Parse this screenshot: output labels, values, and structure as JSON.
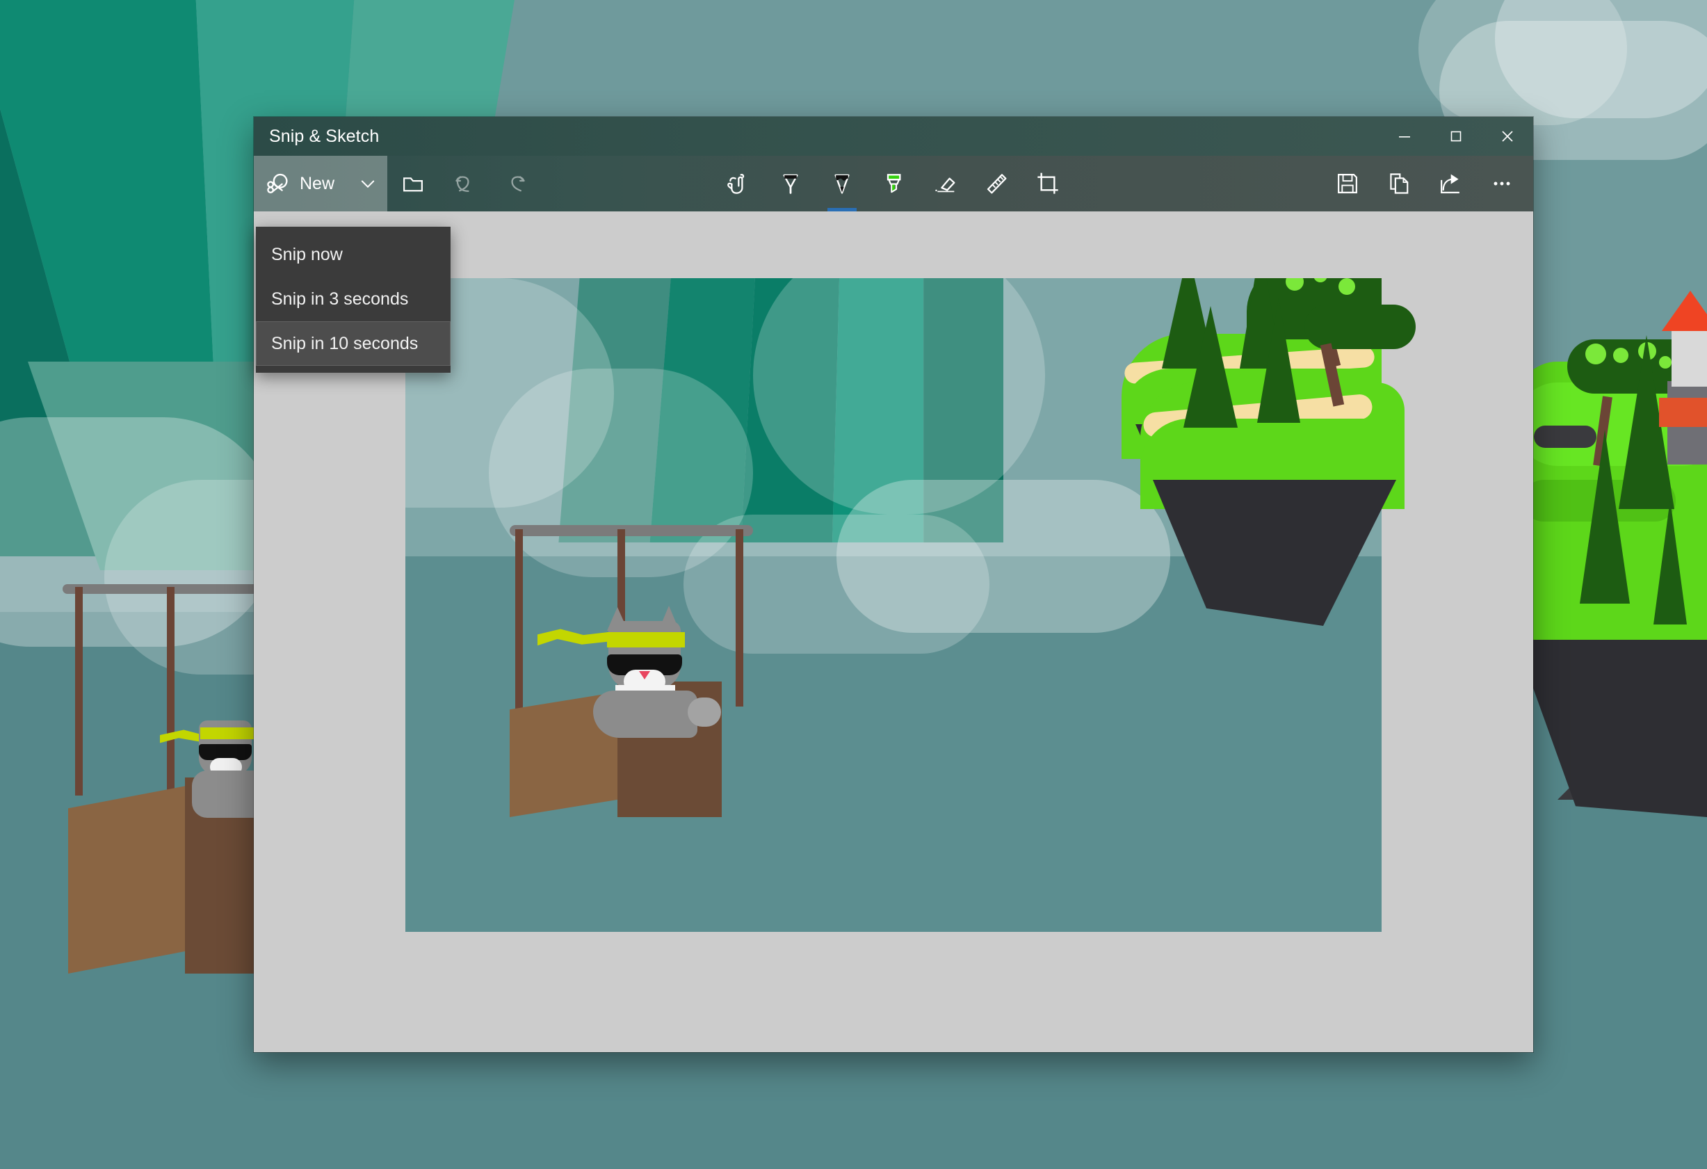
{
  "window": {
    "title": "Snip & Sketch",
    "controls": [
      {
        "name": "minimize",
        "glyph": "minimize-icon",
        "tooltip": "Minimize"
      },
      {
        "name": "maximize",
        "glyph": "maximize-icon",
        "tooltip": "Maximize"
      },
      {
        "name": "close",
        "glyph": "close-icon",
        "tooltip": "Close"
      }
    ]
  },
  "toolbar": {
    "new_label": "New",
    "new_icon": "snip-scissors-icon",
    "new_chevron_icon": "chevron-down-icon",
    "left_tools": [
      {
        "name": "open-file",
        "icon": "folder-icon",
        "enabled": true
      },
      {
        "name": "undo",
        "icon": "undo-arrow-icon",
        "enabled": false
      },
      {
        "name": "redo",
        "icon": "redo-arrow-icon",
        "enabled": false
      }
    ],
    "center_tools": [
      {
        "name": "touch-writing",
        "icon": "touch-hand-icon",
        "active": false
      },
      {
        "name": "ballpoint-pen",
        "icon": "ballpoint-pen-icon",
        "active": false
      },
      {
        "name": "pencil",
        "icon": "pencil-icon",
        "active": true
      },
      {
        "name": "highlighter",
        "icon": "highlighter-icon",
        "active": false,
        "color": "#34d10d"
      },
      {
        "name": "eraser",
        "icon": "eraser-icon",
        "active": false
      },
      {
        "name": "ruler",
        "icon": "ruler-icon",
        "active": false
      },
      {
        "name": "crop",
        "icon": "crop-icon",
        "active": false
      }
    ],
    "right_tools": [
      {
        "name": "save",
        "icon": "save-floppy-icon"
      },
      {
        "name": "copy",
        "icon": "copy-pages-icon"
      },
      {
        "name": "share",
        "icon": "share-arrow-icon"
      },
      {
        "name": "see-more",
        "icon": "ellipsis-icon"
      }
    ],
    "active_tool_underline_color": "#2a6fb5"
  },
  "dropdown": {
    "open": true,
    "items": [
      {
        "label": "Snip now",
        "highlighted": false
      },
      {
        "label": "Snip in 3 seconds",
        "highlighted": false
      },
      {
        "label": "Snip in 10 seconds",
        "highlighted": true
      }
    ]
  },
  "canvas": {
    "background_color": "#cccccc",
    "screenshot_alt": "ninja-cat-hot-air-balloon-screenshot"
  },
  "wallpaper": {
    "name": "windows-ninjacat-balloon-wallpaper",
    "sky_top_color": "#6f9a9c",
    "sky_bottom_color": "#4d8285",
    "balloon_ray_colors": [
      "#00806b",
      "#009b7d",
      "#2aa88e",
      "#35a897",
      "#00715f",
      "#0a6f5e"
    ],
    "island_grass_color": "#5dd71a",
    "island_rock_color": "#3a3a3e",
    "cat": {
      "fur_color": "#8c8c8c",
      "headband_color": "#c3d600",
      "glasses_color": "#111111",
      "nose_color": "#e8455f"
    },
    "basket_color": "#8a6543",
    "rope_color": "#6b4536"
  },
  "colors": {
    "titlebar": "#33514c",
    "toolbar": "#44524f",
    "menu_bg": "#3b3b3b",
    "menu_highlight": "#4d4d4d",
    "accent_blue": "#2a6fb5",
    "highlighter_green": "#34d10d"
  }
}
